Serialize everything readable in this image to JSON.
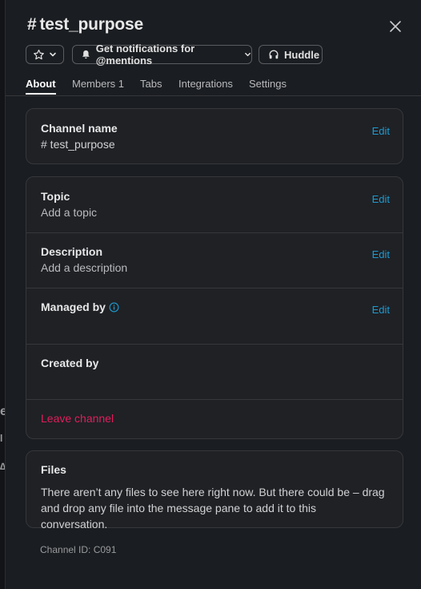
{
  "background": {
    "fragments": [
      "e",
      "l",
      "∆"
    ]
  },
  "header": {
    "hash": "#",
    "channel_name": "test_purpose",
    "close_icon": "close-icon"
  },
  "actions": {
    "star_icon": "star-icon",
    "notifications_label": "Get notifications for @mentions",
    "huddle_label": "Huddle"
  },
  "tabs": [
    {
      "label": "About",
      "active": true
    },
    {
      "label": "Members 1",
      "active": false
    },
    {
      "label": "Tabs",
      "active": false
    },
    {
      "label": "Integrations",
      "active": false
    },
    {
      "label": "Settings",
      "active": false
    }
  ],
  "about": {
    "channel_name": {
      "label": "Channel name",
      "value": "# test_purpose",
      "edit": "Edit"
    },
    "topic": {
      "label": "Topic",
      "value": "Add a topic",
      "edit": "Edit"
    },
    "description": {
      "label": "Description",
      "value": "Add a description",
      "edit": "Edit"
    },
    "managed_by": {
      "label": "Managed by",
      "edit": "Edit"
    },
    "created_by": {
      "label": "Created by"
    },
    "leave": "Leave channel"
  },
  "files": {
    "title": "Files",
    "text": "There aren’t any files to see here right now. But there could be – drag and drop any file into the message pane to add it to this conversation."
  },
  "channel_id": "Channel ID: C091",
  "colors": {
    "background": "#1a1d21",
    "card": "#1f2125",
    "border": "#35373b",
    "link": "#1d9bd1",
    "danger": "#e01e5a"
  }
}
